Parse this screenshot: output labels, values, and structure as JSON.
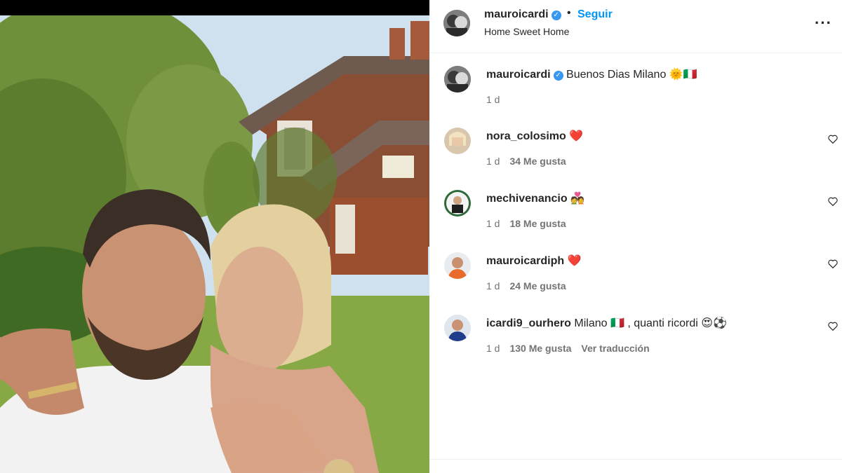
{
  "post": {
    "username": "mauroicardi",
    "separator": "•",
    "follow_label": "Seguir",
    "location": "Home Sweet Home",
    "more_label": "···",
    "verified_mark": "✓"
  },
  "caption": {
    "username": "mauroicardi",
    "text": "Buenos Dias Milano",
    "emoji": "🌞🇮🇹",
    "time": "1 d"
  },
  "comments": [
    {
      "username": "nora_colosimo",
      "text": "",
      "emoji": "❤️",
      "time": "1 d",
      "likes": "34 Me gusta",
      "translate": ""
    },
    {
      "username": "mechivenancio",
      "text": "",
      "emoji": "💑",
      "time": "1 d",
      "likes": "18 Me gusta",
      "translate": ""
    },
    {
      "username": "mauroicardiph",
      "text": "",
      "emoji": "❤️",
      "time": "1 d",
      "likes": "24 Me gusta",
      "translate": ""
    },
    {
      "username": "icardi9_ourhero",
      "text": "Milano 🇮🇹 , quanti ricordi",
      "emoji": "😍⚽",
      "time": "1 d",
      "likes": "130 Me gusta",
      "translate": "Ver traducción"
    }
  ],
  "icons": {
    "like": "heart-outline-icon",
    "more": "more-options-icon",
    "verified": "verified-badge-icon"
  },
  "colors": {
    "follow": "#0095f6",
    "verified": "#3897f0",
    "heart": "#ed1a32"
  }
}
